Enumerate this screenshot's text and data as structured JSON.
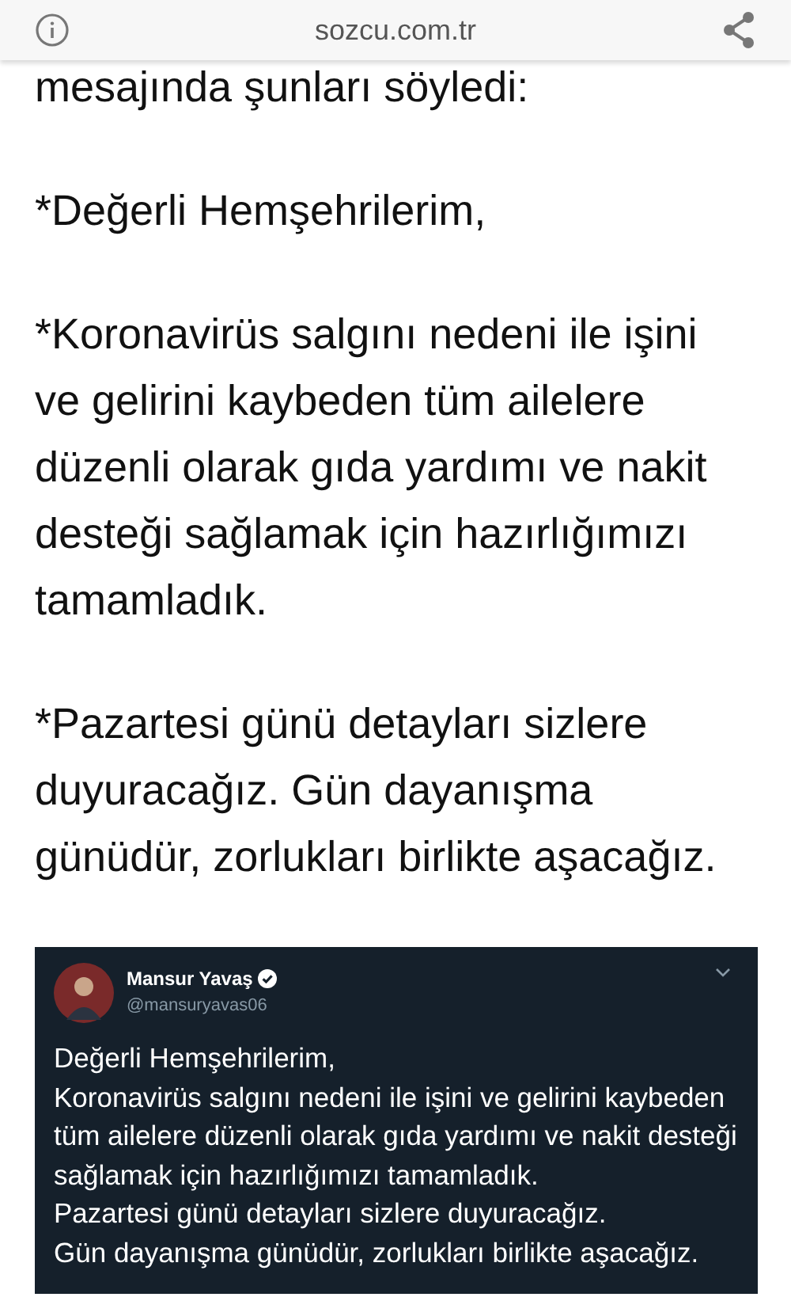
{
  "browser_bar": {
    "url": "sozcu.com.tr"
  },
  "article": {
    "paragraphs": [
      {
        "lines": [
          "mesajında şunları söyledi:"
        ]
      },
      {
        "lines": [
          "*Değerli Hemşehrilerim,"
        ]
      },
      {
        "lines": [
          "*Koronavirüs salgını nedeni ile işini",
          "ve gelirini kaybeden tüm ailelere",
          "düzenli olarak gıda yardımı ve nakit",
          "desteği sağlamak için hazırlığımızı",
          "tamamladık."
        ]
      },
      {
        "lines": [
          "*Pazartesi günü detayları sizlere",
          "duyuracağız. Gün dayanışma",
          "günüdür, zorlukları birlikte aşacağız."
        ]
      }
    ]
  },
  "tweet": {
    "name": "Mansur Yavaş",
    "verified": true,
    "handle": "@mansuryavas06",
    "lines": [
      "Değerli Hemşehrilerim,",
      "Koronavirüs salgını nedeni ile işini ve gelirini kaybeden",
      "tüm ailelere düzenli olarak gıda yardımı ve nakit desteği",
      "sağlamak için hazırlığımızı tamamladık.",
      "Pazartesi günü detayları sizlere duyuracağız.",
      "Gün dayanışma günüdür, zorlukları birlikte aşacağız."
    ]
  }
}
